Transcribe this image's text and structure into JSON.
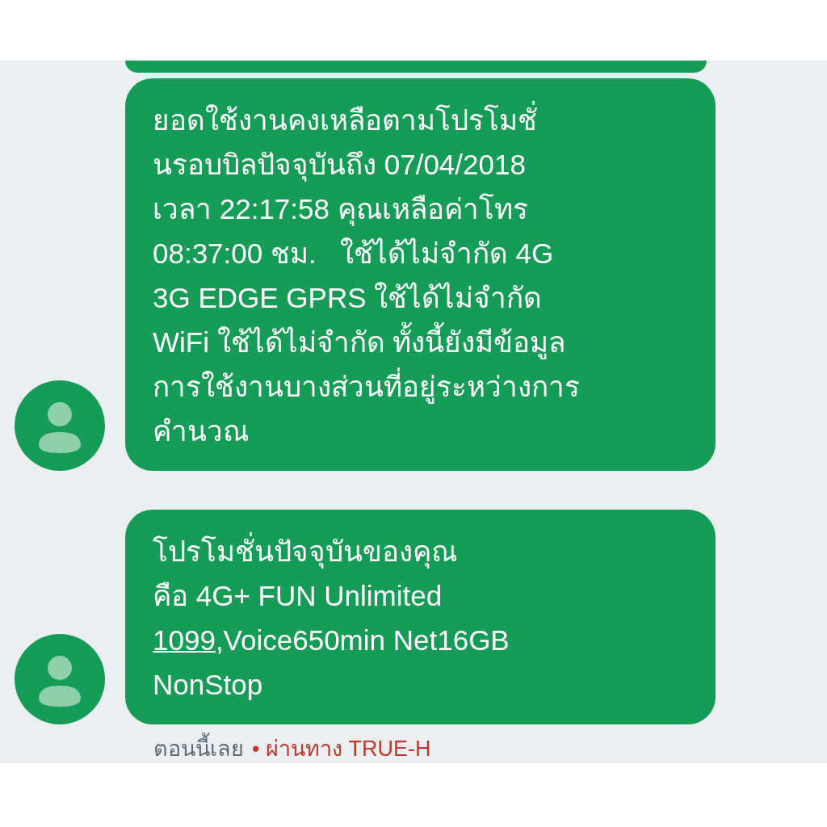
{
  "messages": [
    {
      "kind": "partial"
    },
    {
      "kind": "message",
      "lines": [
        {
          "text": "ยอดใช้งานคงเหลือตามโปรโมชั่"
        },
        {
          "text": "นรอบบิลปัจจุบันถึง 07/04/2018"
        },
        {
          "text": "เวลา 22:17:58 คุณเหลือค่าโทร"
        },
        {
          "text": "08:37:00 ชม.   ใช้ได้ไม่จำกัด 4G"
        },
        {
          "text": "3G EDGE GPRS ใช้ได้ไม่จำกัด"
        },
        {
          "text": "WiFi ใช้ได้ไม่จำกัด ทั้งนี้ยังมีข้อมูล"
        },
        {
          "text": "การใช้งานบางส่วนที่อยู่ระหว่างการ"
        },
        {
          "text": "คำนวณ"
        }
      ]
    },
    {
      "kind": "message",
      "lines": [
        {
          "text": "โปรโมชั่นปัจจุบันของคุณ"
        },
        {
          "text": "คือ 4G+ FUN Unlimited"
        },
        {
          "link": "1099",
          "text": ",Voice650min Net16GB"
        },
        {
          "text": "NonStop"
        }
      ]
    }
  ],
  "footer": {
    "time": "ตอนนี้เลย",
    "via": "• ผ่านทาง TRUE-H"
  }
}
